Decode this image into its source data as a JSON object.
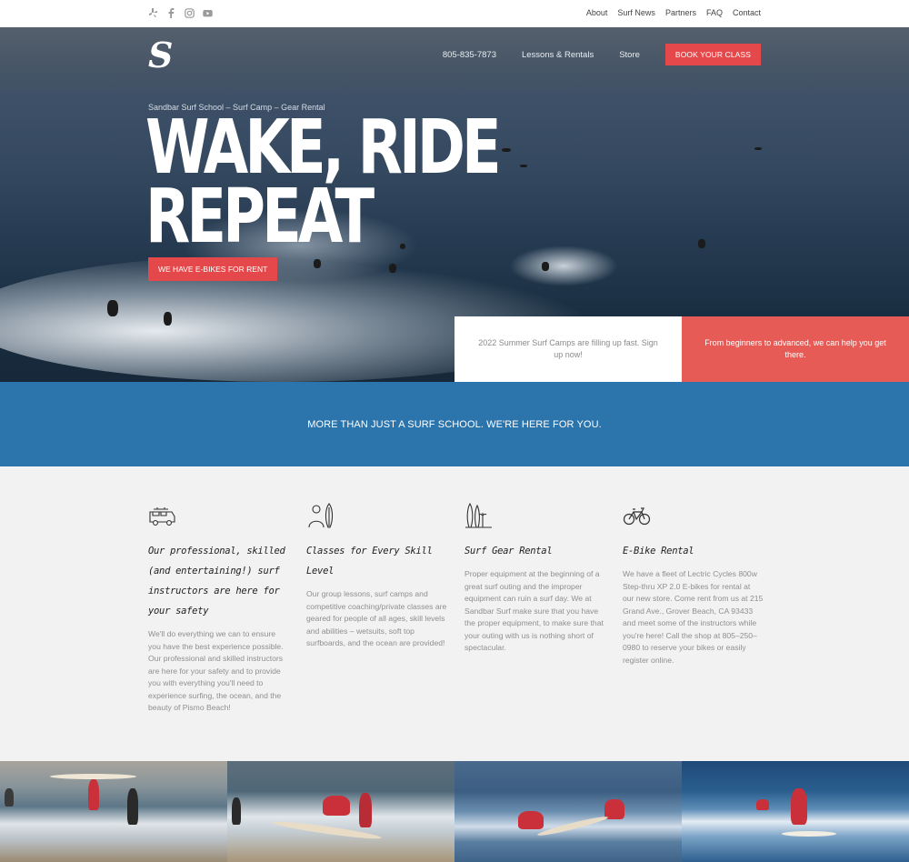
{
  "topbar": {
    "social_icons": [
      "yelp-icon",
      "facebook-icon",
      "instagram-icon",
      "youtube-icon"
    ],
    "nav": [
      "About",
      "Surf News",
      "Partners",
      "FAQ",
      "Contact"
    ]
  },
  "header": {
    "logo_letter": "S",
    "phone": "805-835-7873",
    "nav": [
      "Lessons & Rentals",
      "Store"
    ],
    "cta": "BOOK YOUR CLASS"
  },
  "hero": {
    "subtitle": "Sandbar Surf School – Surf Camp – Gear Rental",
    "title_line1": "WAKE, RIDE",
    "title_line2": "REPEAT",
    "button": "WE HAVE E-BIKES FOR RENT"
  },
  "promos": {
    "white": "2022 Summer Surf Camps are filling up fast. Sign up now!",
    "red": "From beginners to advanced, we can help you get there."
  },
  "banner": {
    "text": "MORE THAN JUST A SURF SCHOOL. WE'RE HERE FOR YOU."
  },
  "features": [
    {
      "icon": "van-icon",
      "title": "Our professional, skilled (and entertaining!) surf instructors are here for your safety",
      "body": "We'll do everything we can to ensure you have the best experience possible. Our professional and skilled instructors are here for your safety and to provide you with everything you'll need to experience surfing, the ocean, and the beauty of Pismo Beach!"
    },
    {
      "icon": "surfer-with-board-icon",
      "title": "Classes for Every Skill Level",
      "body": "Our group lessons, surf camps and competitive coaching/private classes are geared for people of all ages, skill levels and abilities – wetsuits, soft top surfboards, and the ocean are provided!"
    },
    {
      "icon": "surfboards-icon",
      "title": "Surf Gear Rental",
      "body": "Proper equipment at the beginning of a great surf outing and the improper equipment can ruin a surf day. We at Sandbar Surf make sure that you have the proper equipment, to make sure that your outing with us is nothing short of spectacular."
    },
    {
      "icon": "bicycle-icon",
      "title": "E-Bike Rental",
      "body": "We have a fleet of Lectric Cycles 800w Step-thru XP 2.0 E-bikes for rental at our new store. Come rent from us at 215 Grand Ave., Grover Beach, CA 93433 and meet some of the instructors while you're here! Call the shop at 805–250–0980 to reserve your bikes or easily register online."
    }
  ],
  "colors": {
    "accent_red": "#e5484a",
    "banner_blue": "#2c74ac",
    "features_bg": "#f2f2f2"
  }
}
